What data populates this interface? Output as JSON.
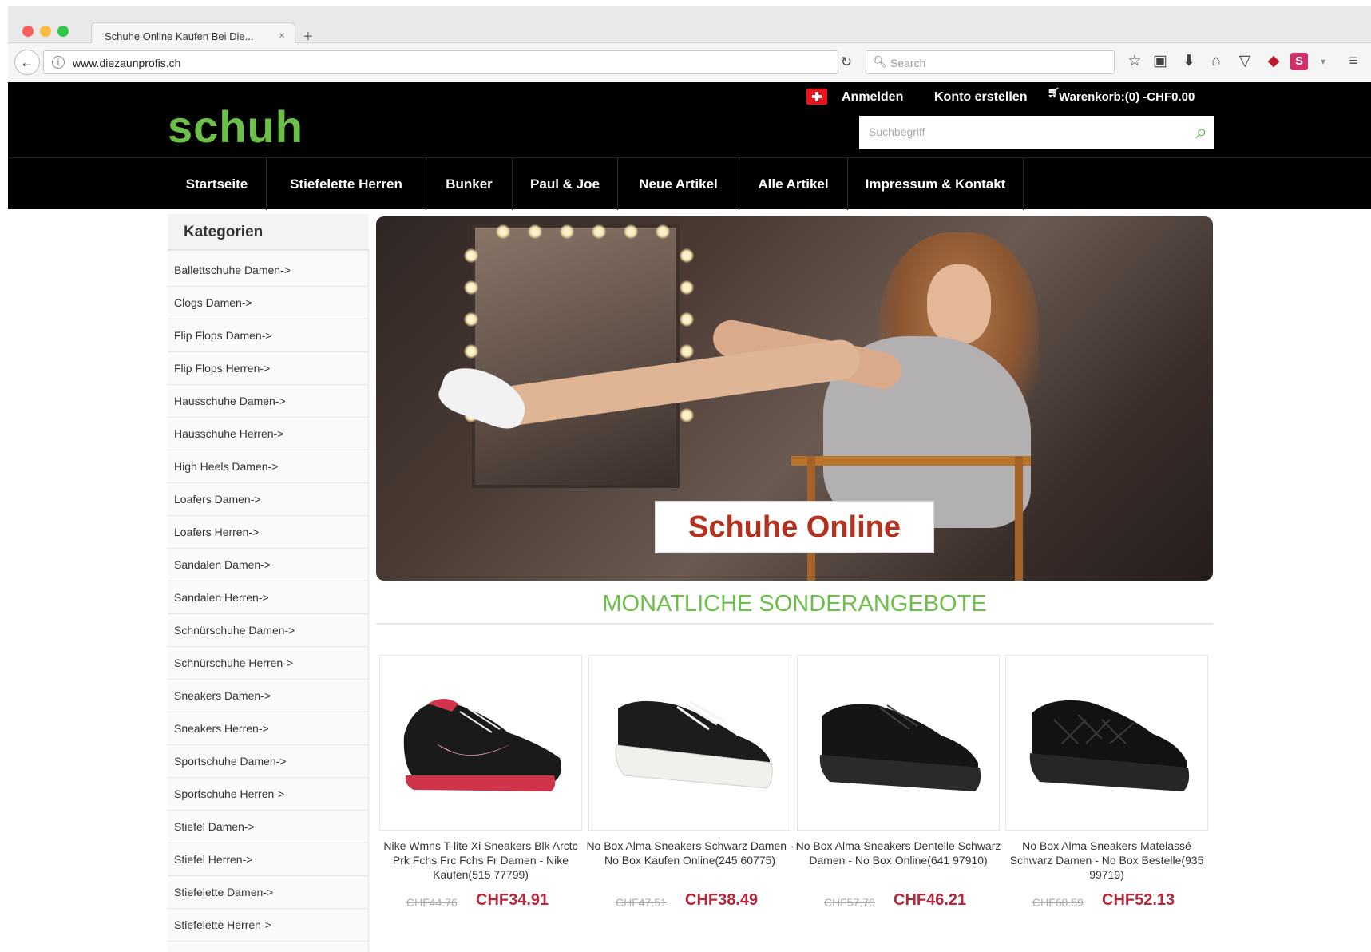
{
  "browser": {
    "tab_title": "Schuhe Online Kaufen Bei Die...",
    "tab_close": "×",
    "new_tab": "+",
    "url": "www.diezaunprofis.ch",
    "search_placeholder": "Search"
  },
  "header": {
    "logo": "schuh",
    "links": [
      "Anmelden",
      "Konto erstellen",
      "Warenkorb:(0) -CHF0.00"
    ],
    "search_placeholder": "Suchbegriff"
  },
  "nav": [
    "Startseite",
    "Stiefelette Herren",
    "Bunker",
    "Paul & Joe",
    "Neue Artikel",
    "Alle Artikel",
    "Impressum & Kontakt"
  ],
  "sidebar": {
    "title": "Kategorien",
    "categories": [
      "Ballettschuhe Damen->",
      "Clogs Damen->",
      "Flip Flops Damen->",
      "Flip Flops Herren->",
      "Hausschuhe Damen->",
      "Hausschuhe Herren->",
      "High Heels Damen->",
      "Loafers Damen->",
      "Loafers Herren->",
      "Sandalen Damen->",
      "Sandalen Herren->",
      "Schnürschuhe Damen->",
      "Schnürschuhe Herren->",
      "Sneakers Damen->",
      "Sneakers Herren->",
      "Sportschuhe Damen->",
      "Sportschuhe Herren->",
      "Stiefel Damen->",
      "Stiefel Herren->",
      "Stiefelette Damen->",
      "Stiefelette Herren->"
    ]
  },
  "hero": {
    "label": "Schuhe Online"
  },
  "offers": {
    "title": "MONATLICHE SONDERANGEBOTE",
    "products": [
      {
        "name": "Nike Wmns T-lite Xi Sneakers Blk Arctc Prk Fchs Frc Fchs Fr Damen - Nike Kaufen(515 77799)",
        "old_price": "CHF44.76",
        "new_price": "CHF34.91"
      },
      {
        "name": "No Box Alma Sneakers Schwarz Damen - No Box Kaufen Online(245 60775)",
        "old_price": "CHF47.51",
        "new_price": "CHF38.49"
      },
      {
        "name": "No Box Alma Sneakers Dentelle Schwarz Damen - No Box Online(641 97910)",
        "old_price": "CHF57.76",
        "new_price": "CHF46.21"
      },
      {
        "name": "No Box Alma Sneakers Matelassé Schwarz Damen - No Box Bestelle(935 99719)",
        "old_price": "CHF68.59",
        "new_price": "CHF52.13"
      }
    ]
  },
  "colors": {
    "brand_green": "#6cc04a",
    "price_red": "#b3283a",
    "header_black": "#000000"
  }
}
